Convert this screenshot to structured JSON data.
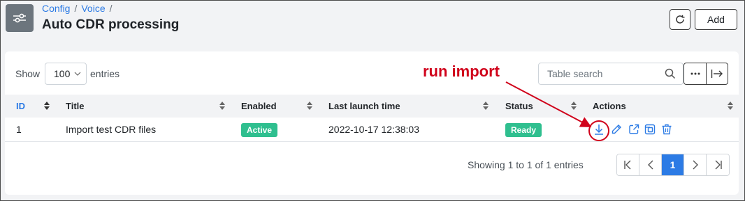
{
  "header": {
    "breadcrumb": [
      "Config",
      "Voice"
    ],
    "title": "Auto CDR processing",
    "add_label": "Add"
  },
  "toolbar": {
    "show_label": "Show",
    "page_size": "100",
    "entries_label": "entries",
    "search_placeholder": "Table search"
  },
  "table": {
    "columns": [
      "ID",
      "Title",
      "Enabled",
      "Last launch time",
      "Status",
      "Actions"
    ],
    "rows": [
      {
        "id": "1",
        "title": "Import test CDR files",
        "enabled": "Active",
        "last_launch": "2022-10-17 12:38:03",
        "status": "Ready"
      }
    ]
  },
  "footer": {
    "showing": "Showing 1 to 1 of 1 entries",
    "current_page": "1"
  },
  "annotation": {
    "text": "run import",
    "color": "#d0021b"
  },
  "colors": {
    "accent": "#2c7be5",
    "badge": "#2fbf8f"
  }
}
